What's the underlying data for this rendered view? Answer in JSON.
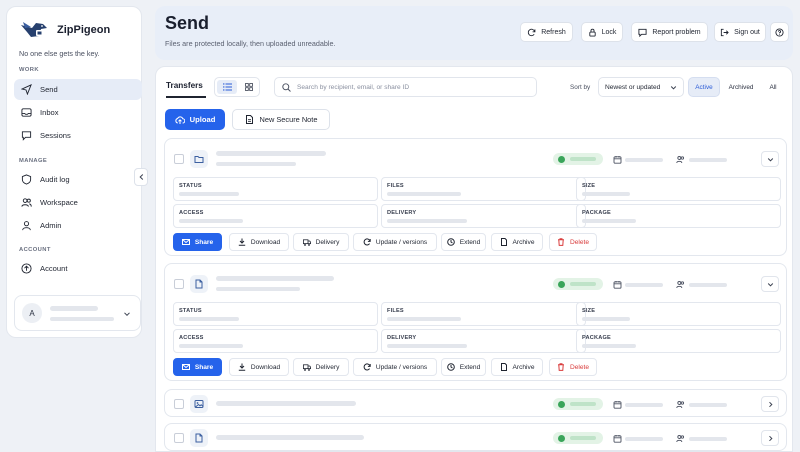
{
  "app": {
    "name": "ZipPigeon",
    "tagline": "No one else gets the key."
  },
  "sidebar": {
    "sections": {
      "work": "WORK",
      "manage": "MANAGE",
      "account": "ACCOUNT"
    },
    "items": [
      {
        "label": "Send",
        "icon": "send-icon",
        "active": true
      },
      {
        "label": "Inbox",
        "icon": "inbox-icon"
      },
      {
        "label": "Sessions",
        "icon": "chat-icon"
      },
      {
        "label": "Audit log",
        "icon": "shield-icon"
      },
      {
        "label": "Workspace",
        "icon": "users-icon"
      },
      {
        "label": "Admin",
        "icon": "user-icon"
      },
      {
        "label": "Account",
        "icon": "account-circle-icon"
      }
    ],
    "user": {
      "initial": "A"
    }
  },
  "header": {
    "title": "Send",
    "subtitle": "Files are protected locally, then uploaded unreadable.",
    "buttons": {
      "refresh": "Refresh",
      "lock": "Lock",
      "report": "Report problem",
      "signout": "Sign out"
    }
  },
  "toolbar": {
    "tab": "Transfers",
    "search_placeholder": "Search by recipient, email, or share ID",
    "sort_label": "Sort by",
    "sort_value": "Newest or updated",
    "filters": [
      "Active",
      "Archived",
      "All"
    ],
    "active_filter": "Active",
    "upload": "Upload",
    "new_note": "New Secure Note"
  },
  "card_fields": {
    "status": "STATUS",
    "files": "FILES",
    "size": "SIZE",
    "access": "ACCESS",
    "delivery": "DELIVERY",
    "package": "PACKAGE"
  },
  "actions": {
    "share": "Share",
    "download": "Download",
    "delivery": "Delivery",
    "update": "Update / versions",
    "extend": "Extend",
    "archive": "Archive",
    "delete": "Delete"
  },
  "colors": {
    "accent": "#2563eb",
    "danger": "#d93c3c",
    "status_ok": "#3aa55a"
  }
}
